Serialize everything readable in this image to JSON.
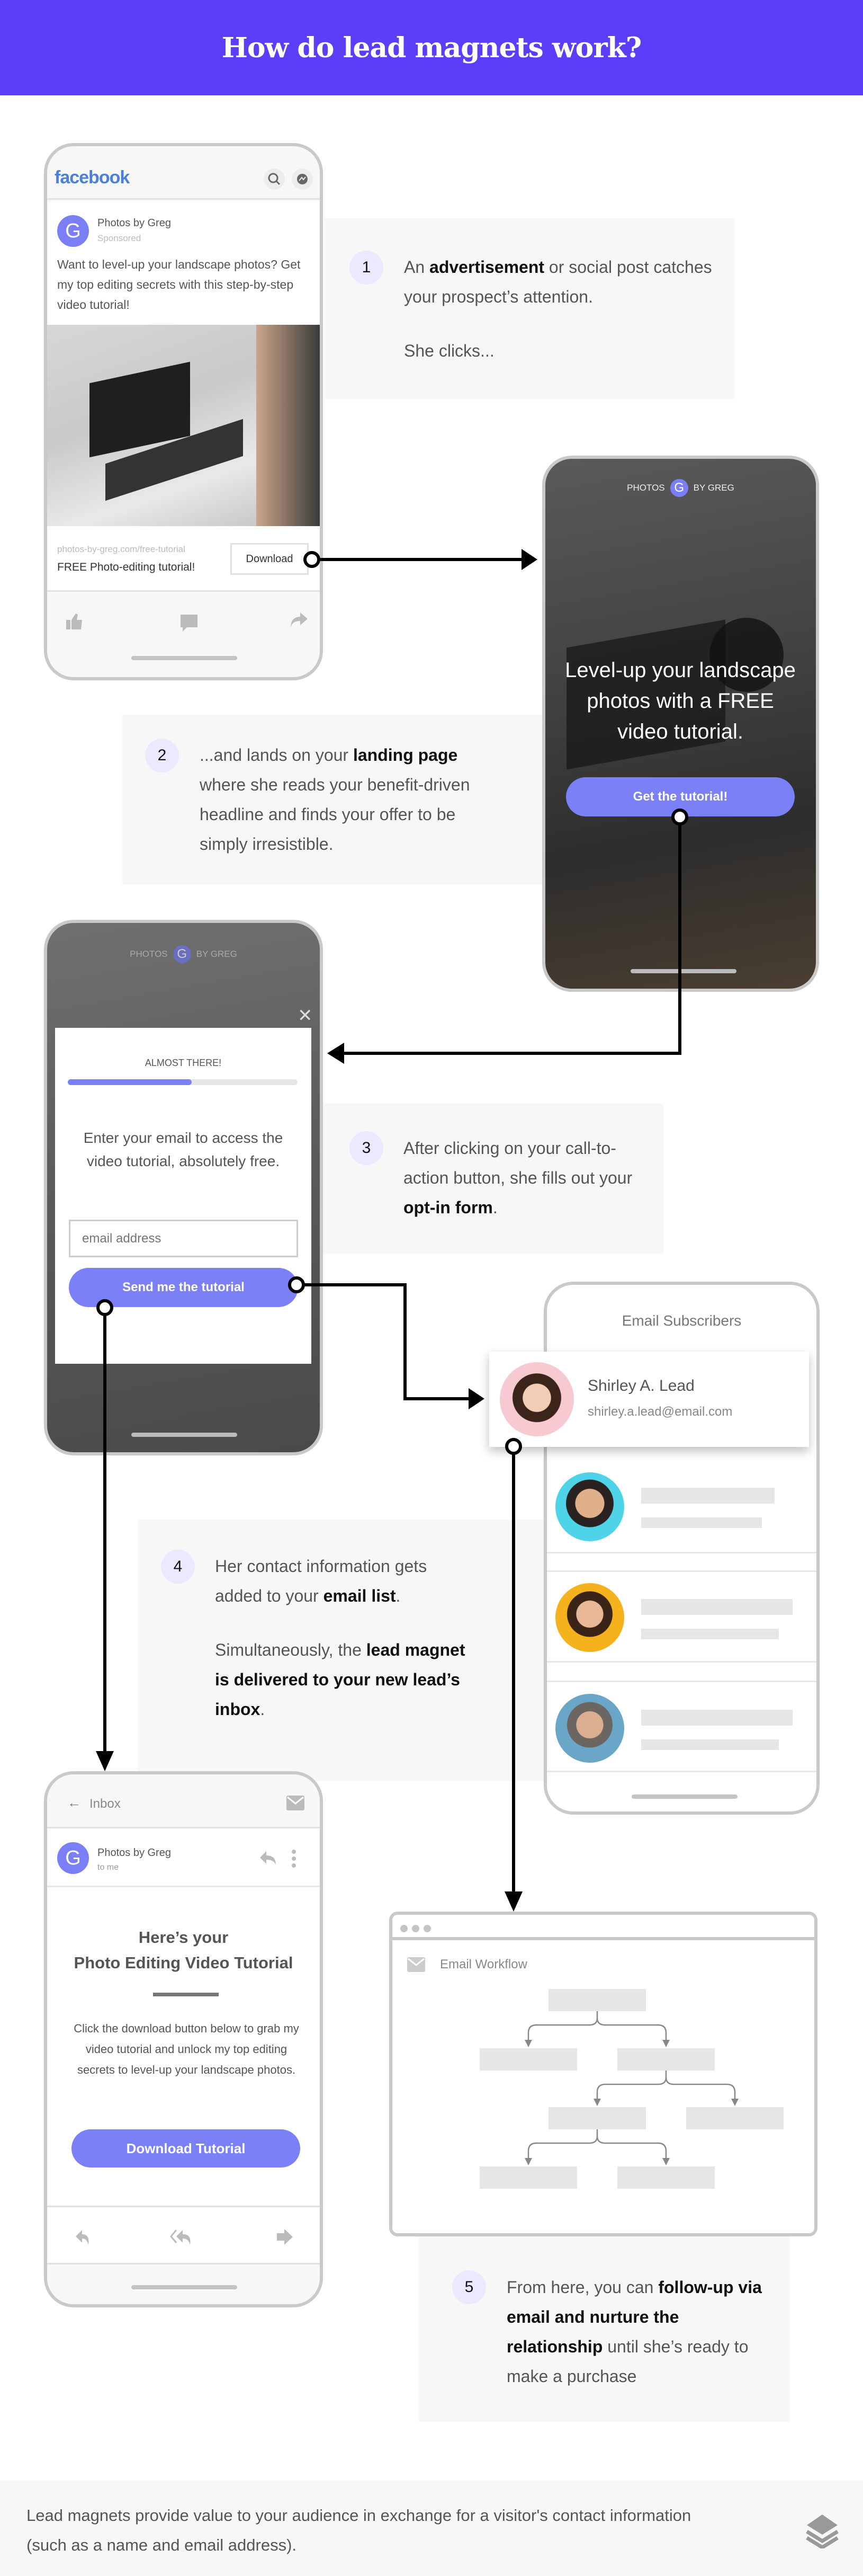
{
  "title": "How do lead magnets work?",
  "colors": {
    "header": "#5b3ff8",
    "accent": "#7b80f7",
    "badge": "#ebe8ff",
    "panel": "#f7f7f7"
  },
  "steps": [
    {
      "number": "1",
      "parts": [
        "An ",
        "advertisement",
        " or social post catches your prospect’s attention."
      ],
      "para2": "She clicks..."
    },
    {
      "number": "2",
      "parts": [
        "...and lands on your ",
        "landing page",
        " where she reads your benefit-driven headline and finds your offer to be simply irresistible."
      ]
    },
    {
      "number": "3",
      "parts": [
        "After clicking on your call-to-action button, she fills out your ",
        "opt-in form",
        "."
      ]
    },
    {
      "number": "4",
      "parts": [
        "Her contact information gets added to your ",
        "email list",
        "."
      ],
      "para2_parts": [
        "Simultaneously, the ",
        "lead magnet is delivered to your new lead’s inbox",
        "."
      ]
    },
    {
      "number": "5",
      "parts": [
        "From here, you can ",
        "follow-up via email and nurture the relationship",
        " until she’s ready to make a purchase"
      ]
    }
  ],
  "facebook_ad": {
    "logo": "facebook",
    "icons": [
      "search-icon",
      "messenger-icon"
    ],
    "page_name": "Photos by Greg",
    "avatar_letter": "G",
    "sponsored": "Sponsored",
    "post_text": "Want to level-up your landscape photos? Get my top editing secrets with this step-by-step video tutorial!",
    "link_url": "photos-by-greg.com/free-tutorial",
    "link_title": "FREE Photo-editing tutorial!",
    "cta": "Download",
    "actions": [
      "like-icon",
      "comment-icon",
      "share-icon"
    ]
  },
  "landing_page": {
    "brand_left": "PHOTOS",
    "brand_letter": "G",
    "brand_right": "BY GREG",
    "headline": "Level-up your landscape photos with a FREE video tutorial.",
    "cta": "Get the tutorial!"
  },
  "optin": {
    "brand_left": "PHOTOS",
    "brand_letter": "G",
    "brand_right": "BY GREG",
    "progress_label": "ALMOST THERE!",
    "progress_percent": 54,
    "text": "Enter your email to access the video tutorial, absolutely free.",
    "email_placeholder": "email address",
    "submit": "Send me the tutorial"
  },
  "subscribers": {
    "title": "Email Subscribers",
    "new_lead": {
      "name": "Shirley A. Lead",
      "email": "shirley.a.lead@email.com"
    }
  },
  "inbox": {
    "back_label": "Inbox",
    "sender": "Photos by Greg",
    "avatar_letter": "G",
    "to": "to me",
    "heading_line1": "Here’s your",
    "heading_line2": "Photo Editing Video Tutorial",
    "body": "Click the download button below to grab my video tutorial and unlock my top editing secrets to level-up your landscape photos.",
    "cta": "Download Tutorial"
  },
  "workflow": {
    "title": "Email Workflow"
  },
  "footer": {
    "text": "Lead magnets provide value to your audience in exchange for a visitor's contact information (such as a name and email address).",
    "logo_icon": "layers-logo-icon"
  }
}
